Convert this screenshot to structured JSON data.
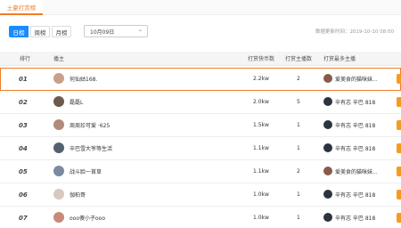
{
  "tabs": {
    "active_label": "土豪打赏榜"
  },
  "filters": {
    "day": "日榜",
    "week": "周榜",
    "month": "月榜",
    "date_value": "10月09日"
  },
  "update_time": "数据更新时间：2019-10-10 08:00",
  "table": {
    "headers": {
      "rank": "排行",
      "host": "播主",
      "coins": "打赏快币数",
      "count": "打赏主播数",
      "top": "打赏最多主播"
    },
    "rows": [
      {
        "rank": "01",
        "name": "何仙姑168.",
        "coins": "2.2kw",
        "count": "2",
        "top": "爱美食的猫咪妹...",
        "avatar_color": "#c9a08a",
        "top_avatar_color": "#8a5a4a"
      },
      {
        "rank": "02",
        "name": "磊磊L",
        "coins": "2.0kw",
        "count": "5",
        "top": "辛有志 辛巴 818",
        "avatar_color": "#6d5a4d",
        "top_avatar_color": "#2d3440"
      },
      {
        "rank": "03",
        "name": "周周珍可爱 ·625",
        "coins": "1.5kw",
        "count": "1",
        "top": "辛有志 辛巴 818",
        "avatar_color": "#b08a7a",
        "top_avatar_color": "#2d3440"
      },
      {
        "rank": "04",
        "name": "辛巴雪大爷等生活",
        "coins": "1.1kw",
        "count": "1",
        "top": "辛有志 辛巴 818",
        "avatar_color": "#556070",
        "top_avatar_color": "#2d3440"
      },
      {
        "rank": "05",
        "name": "战斗脸一首草",
        "coins": "1.1kw",
        "count": "2",
        "top": "爱美食的猫咪妹...",
        "avatar_color": "#7a8aa0",
        "top_avatar_color": "#8a5a4a"
      },
      {
        "rank": "06",
        "name": "伽柏哥",
        "coins": "1.0kw",
        "count": "1",
        "top": "辛有志 辛巴 818",
        "avatar_color": "#d8c8c0",
        "top_avatar_color": "#2d3440"
      },
      {
        "rank": "07",
        "name": "ooo傻小子ooo",
        "coins": "1.0kw",
        "count": "1",
        "top": "辛有志 辛巴 818",
        "avatar_color": "#c98a7a",
        "top_avatar_color": "#2d3440"
      }
    ]
  }
}
